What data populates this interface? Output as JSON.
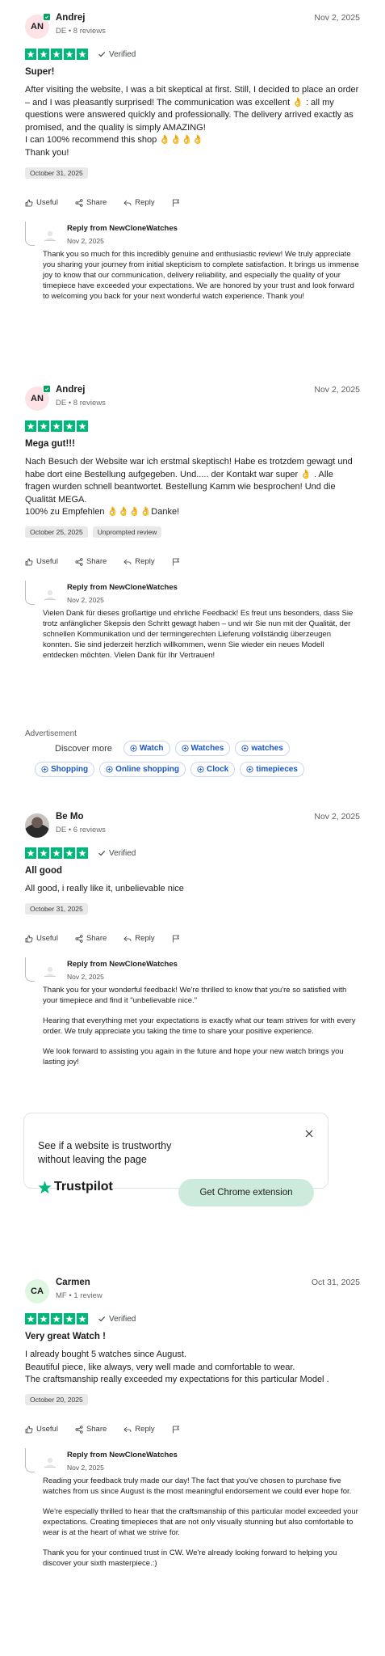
{
  "reviews": [
    {
      "avatar_initials": "AN",
      "name": "Andrej",
      "meta": "DE • 8 reviews",
      "date": "Nov 2, 2025",
      "rating": 5,
      "verified": "Verified",
      "title": "Super!",
      "body": "After visiting the website, I was a bit skeptical at first. Still, I decided to place an order – and I was pleasantly surprised! The communication was excellent 👌 : all my questions were answered quickly and professionally. The delivery arrived exactly as promised, and the quality is simply AMAZING!\nI can 100% recommend this shop 👌👌👌👌\nThank you!",
      "tags": [
        "October 31, 2025"
      ],
      "reply_from": "Reply from NewCloneWatches",
      "reply_date": "Nov 2, 2025",
      "reply_paragraphs": [
        "Thank you so much for this incredibly genuine and enthusiastic review! We truly appreciate you sharing your journey from initial skepticism to complete satisfaction. It brings us immense joy to know that our communication, delivery reliability, and especially the quality of your timepiece have exceeded your expectations. We are honored by your trust and look forward to welcoming you back for your next wonderful watch experience. Thank you!"
      ]
    },
    {
      "avatar_initials": "AN",
      "name": "Andrej",
      "meta": "DE • 8 reviews",
      "date": "Nov 2, 2025",
      "rating": 5,
      "verified": "",
      "title": "Mega gut!!!",
      "body": "Nach Besuch der Website war ich erstmal skeptisch! Habe es trotzdem gewagt und habe dort eine Bestellung aufgegeben. Und..... der Kontakt war super 👌 . Alle fragen wurden schnell beantwortet. Bestellung Kamm wie besprochen! Und die Qualität MEGA.\n100% zu Empfehlen 👌👌👌👌Danke!",
      "tags": [
        "October 25, 2025",
        "Unprompted review"
      ],
      "reply_from": "Reply from NewCloneWatches",
      "reply_date": "Nov 2, 2025",
      "reply_paragraphs": [
        "Vielen Dank für dieses großartige und ehrliche Feedback! Es freut uns besonders, dass Sie trotz anfänglicher Skepsis den Schritt gewagt haben – und wir Sie nun mit der Qualität, der schnellen Kommunikation und der termingerechten Lieferung vollständig überzeugen konnten. Sie sind jederzeit herzlich willkommen, wenn Sie wieder ein neues Modell entdecken möchten. Vielen Dank für Ihr Vertrauen!"
      ]
    },
    {
      "avatar_initials": "",
      "name": "Be Mo",
      "meta": "DE • 6 reviews",
      "date": "Nov 2, 2025",
      "rating": 5,
      "verified": "Verified",
      "title": "All good",
      "body": "All good, i really like it, unbelievable nice",
      "tags": [
        "October 31, 2025"
      ],
      "reply_from": "Reply from NewCloneWatches",
      "reply_date": "Nov 2, 2025",
      "reply_paragraphs": [
        "Thank you for your wonderful feedback! We're thrilled to know that you're so satisfied with your timepiece and find it \"unbelievable nice.\"",
        "Hearing that everything met your expectations is exactly what our team strives for with every order. We truly appreciate you taking the time to share your positive experience.",
        "We look forward to assisting you again in the future and hope your new watch brings you lasting joy!"
      ]
    },
    {
      "avatar_initials": "CA",
      "name": "Carmen",
      "meta": "MF • 1 review",
      "date": "Oct 31, 2025",
      "rating": 5,
      "verified": "Verified",
      "title": "Very great Watch !",
      "body": "I already bought 5 watches since August.\nBeautiful piece, like always, very well made and comfortable to wear.\nThe craftsmanship really exceeded my expectations for this particular Model .",
      "tags": [
        "October 20, 2025"
      ],
      "reply_from": "Reply from NewCloneWatches",
      "reply_date": "Nov 2, 2025",
      "reply_paragraphs": [
        "Reading your feedback truly made our day! The fact that you've chosen to purchase five watches from us since August is the most meaningful endorsement we could ever hope for.",
        "We're especially thrilled to hear that the craftsmanship of this particular model exceeded your expectations. Creating timepieces that are not only visually stunning but also comfortable to wear is at the heart of what we strive for.",
        "Thank you for your continued trust in CW. We're already looking forward to helping you discover your sixth masterpiece.:)"
      ]
    }
  ],
  "actions": {
    "useful": "Useful",
    "share": "Share",
    "reply": "Reply"
  },
  "ad": {
    "label": "Advertisement",
    "discover": "Discover more",
    "chips": [
      "Watch",
      "Watches",
      "watches",
      "Shopping",
      "Online shopping",
      "Clock",
      "timepieces"
    ]
  },
  "promo": {
    "text": "See if a website is trustworthy without leaving the page",
    "brand": "Trustpilot",
    "button": "Get Chrome extension"
  },
  "colors": {
    "star_green": "#00b67a",
    "verified_green": "#04a460",
    "chip_blue": "#1a56c5",
    "promo_button": "#cdebdd"
  }
}
